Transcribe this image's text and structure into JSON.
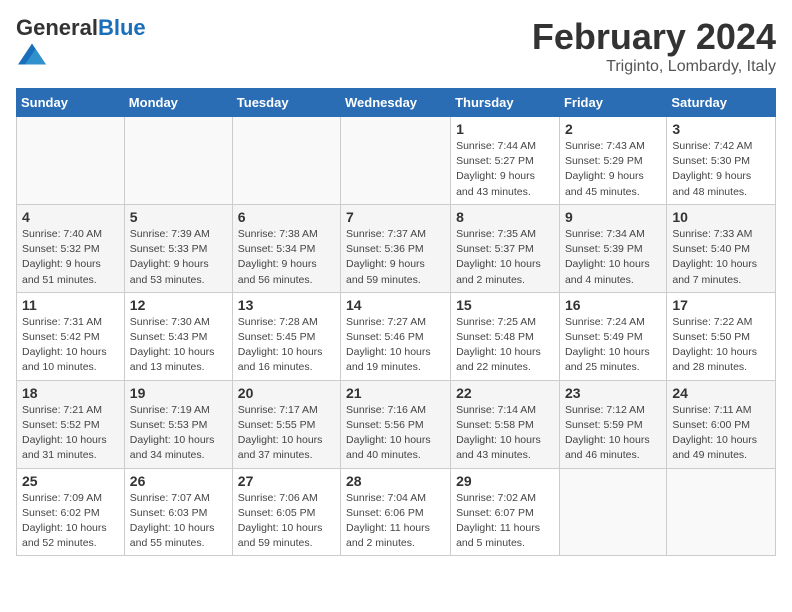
{
  "header": {
    "logo_general": "General",
    "logo_blue": "Blue",
    "main_title": "February 2024",
    "subtitle": "Triginto, Lombardy, Italy"
  },
  "days_of_week": [
    "Sunday",
    "Monday",
    "Tuesday",
    "Wednesday",
    "Thursday",
    "Friday",
    "Saturday"
  ],
  "weeks": [
    [
      {
        "day": "",
        "info": ""
      },
      {
        "day": "",
        "info": ""
      },
      {
        "day": "",
        "info": ""
      },
      {
        "day": "",
        "info": ""
      },
      {
        "day": "1",
        "info": "Sunrise: 7:44 AM\nSunset: 5:27 PM\nDaylight: 9 hours\nand 43 minutes."
      },
      {
        "day": "2",
        "info": "Sunrise: 7:43 AM\nSunset: 5:29 PM\nDaylight: 9 hours\nand 45 minutes."
      },
      {
        "day": "3",
        "info": "Sunrise: 7:42 AM\nSunset: 5:30 PM\nDaylight: 9 hours\nand 48 minutes."
      }
    ],
    [
      {
        "day": "4",
        "info": "Sunrise: 7:40 AM\nSunset: 5:32 PM\nDaylight: 9 hours\nand 51 minutes."
      },
      {
        "day": "5",
        "info": "Sunrise: 7:39 AM\nSunset: 5:33 PM\nDaylight: 9 hours\nand 53 minutes."
      },
      {
        "day": "6",
        "info": "Sunrise: 7:38 AM\nSunset: 5:34 PM\nDaylight: 9 hours\nand 56 minutes."
      },
      {
        "day": "7",
        "info": "Sunrise: 7:37 AM\nSunset: 5:36 PM\nDaylight: 9 hours\nand 59 minutes."
      },
      {
        "day": "8",
        "info": "Sunrise: 7:35 AM\nSunset: 5:37 PM\nDaylight: 10 hours\nand 2 minutes."
      },
      {
        "day": "9",
        "info": "Sunrise: 7:34 AM\nSunset: 5:39 PM\nDaylight: 10 hours\nand 4 minutes."
      },
      {
        "day": "10",
        "info": "Sunrise: 7:33 AM\nSunset: 5:40 PM\nDaylight: 10 hours\nand 7 minutes."
      }
    ],
    [
      {
        "day": "11",
        "info": "Sunrise: 7:31 AM\nSunset: 5:42 PM\nDaylight: 10 hours\nand 10 minutes."
      },
      {
        "day": "12",
        "info": "Sunrise: 7:30 AM\nSunset: 5:43 PM\nDaylight: 10 hours\nand 13 minutes."
      },
      {
        "day": "13",
        "info": "Sunrise: 7:28 AM\nSunset: 5:45 PM\nDaylight: 10 hours\nand 16 minutes."
      },
      {
        "day": "14",
        "info": "Sunrise: 7:27 AM\nSunset: 5:46 PM\nDaylight: 10 hours\nand 19 minutes."
      },
      {
        "day": "15",
        "info": "Sunrise: 7:25 AM\nSunset: 5:48 PM\nDaylight: 10 hours\nand 22 minutes."
      },
      {
        "day": "16",
        "info": "Sunrise: 7:24 AM\nSunset: 5:49 PM\nDaylight: 10 hours\nand 25 minutes."
      },
      {
        "day": "17",
        "info": "Sunrise: 7:22 AM\nSunset: 5:50 PM\nDaylight: 10 hours\nand 28 minutes."
      }
    ],
    [
      {
        "day": "18",
        "info": "Sunrise: 7:21 AM\nSunset: 5:52 PM\nDaylight: 10 hours\nand 31 minutes."
      },
      {
        "day": "19",
        "info": "Sunrise: 7:19 AM\nSunset: 5:53 PM\nDaylight: 10 hours\nand 34 minutes."
      },
      {
        "day": "20",
        "info": "Sunrise: 7:17 AM\nSunset: 5:55 PM\nDaylight: 10 hours\nand 37 minutes."
      },
      {
        "day": "21",
        "info": "Sunrise: 7:16 AM\nSunset: 5:56 PM\nDaylight: 10 hours\nand 40 minutes."
      },
      {
        "day": "22",
        "info": "Sunrise: 7:14 AM\nSunset: 5:58 PM\nDaylight: 10 hours\nand 43 minutes."
      },
      {
        "day": "23",
        "info": "Sunrise: 7:12 AM\nSunset: 5:59 PM\nDaylight: 10 hours\nand 46 minutes."
      },
      {
        "day": "24",
        "info": "Sunrise: 7:11 AM\nSunset: 6:00 PM\nDaylight: 10 hours\nand 49 minutes."
      }
    ],
    [
      {
        "day": "25",
        "info": "Sunrise: 7:09 AM\nSunset: 6:02 PM\nDaylight: 10 hours\nand 52 minutes."
      },
      {
        "day": "26",
        "info": "Sunrise: 7:07 AM\nSunset: 6:03 PM\nDaylight: 10 hours\nand 55 minutes."
      },
      {
        "day": "27",
        "info": "Sunrise: 7:06 AM\nSunset: 6:05 PM\nDaylight: 10 hours\nand 59 minutes."
      },
      {
        "day": "28",
        "info": "Sunrise: 7:04 AM\nSunset: 6:06 PM\nDaylight: 11 hours\nand 2 minutes."
      },
      {
        "day": "29",
        "info": "Sunrise: 7:02 AM\nSunset: 6:07 PM\nDaylight: 11 hours\nand 5 minutes."
      },
      {
        "day": "",
        "info": ""
      },
      {
        "day": "",
        "info": ""
      }
    ]
  ]
}
